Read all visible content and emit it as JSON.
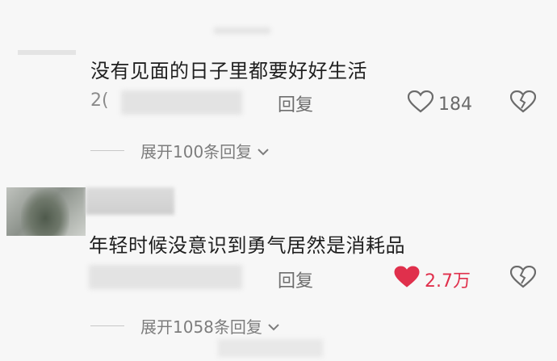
{
  "comments": [
    {
      "text": "没有见面的日子里都要好好生活",
      "meta_prefix": "2(",
      "reply_label": "回复",
      "like_count": "184",
      "liked": false,
      "expand_label": "展开100条回复"
    },
    {
      "text": "年轻时候没意识到勇气居然是消耗品",
      "reply_label": "回复",
      "like_count": "2.7万",
      "liked": true,
      "expand_label": "展开1058条回复"
    }
  ],
  "icons": {
    "heart_outline": "heart-icon",
    "heart_filled": "heart-filled-icon",
    "dislike": "broken-heart-icon",
    "chevron": "chevron-down-icon"
  },
  "colors": {
    "liked_red": "#e0304c",
    "text_dark": "#1f1f1f",
    "text_gray": "#8b8b8b"
  }
}
